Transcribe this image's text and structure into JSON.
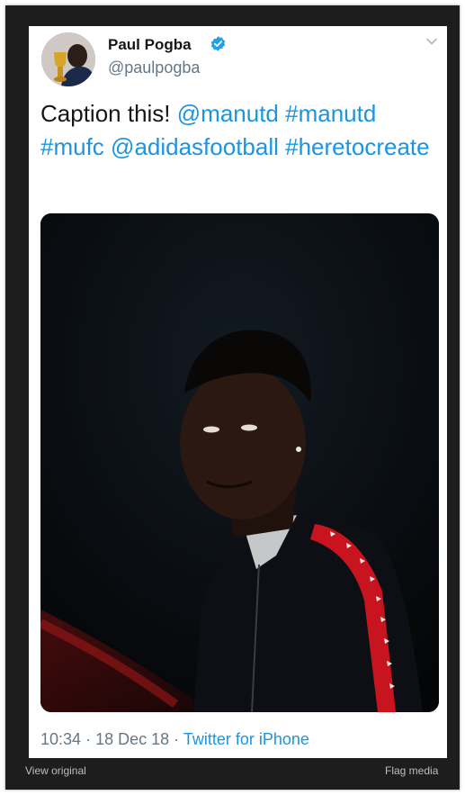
{
  "tweet": {
    "author_name": "Paul Pogba",
    "author_handle": "@paulpogba",
    "text_parts": [
      "Caption this!",
      "@manutd",
      "#manutd",
      "#mufc",
      "@adidasfootball",
      "#heretocreate"
    ],
    "time": "10:34",
    "date": "18 Dec 18",
    "separator": "·",
    "source": "Twitter for iPhone"
  },
  "footer": {
    "view_original": "View original",
    "flag_media": "Flag media"
  },
  "colors": {
    "link": "#1b95e0",
    "secondary": "#657786",
    "frame": "#1d1d1d"
  },
  "icons": {
    "verified": "verified-badge-icon",
    "chevron": "chevron-down-icon"
  }
}
